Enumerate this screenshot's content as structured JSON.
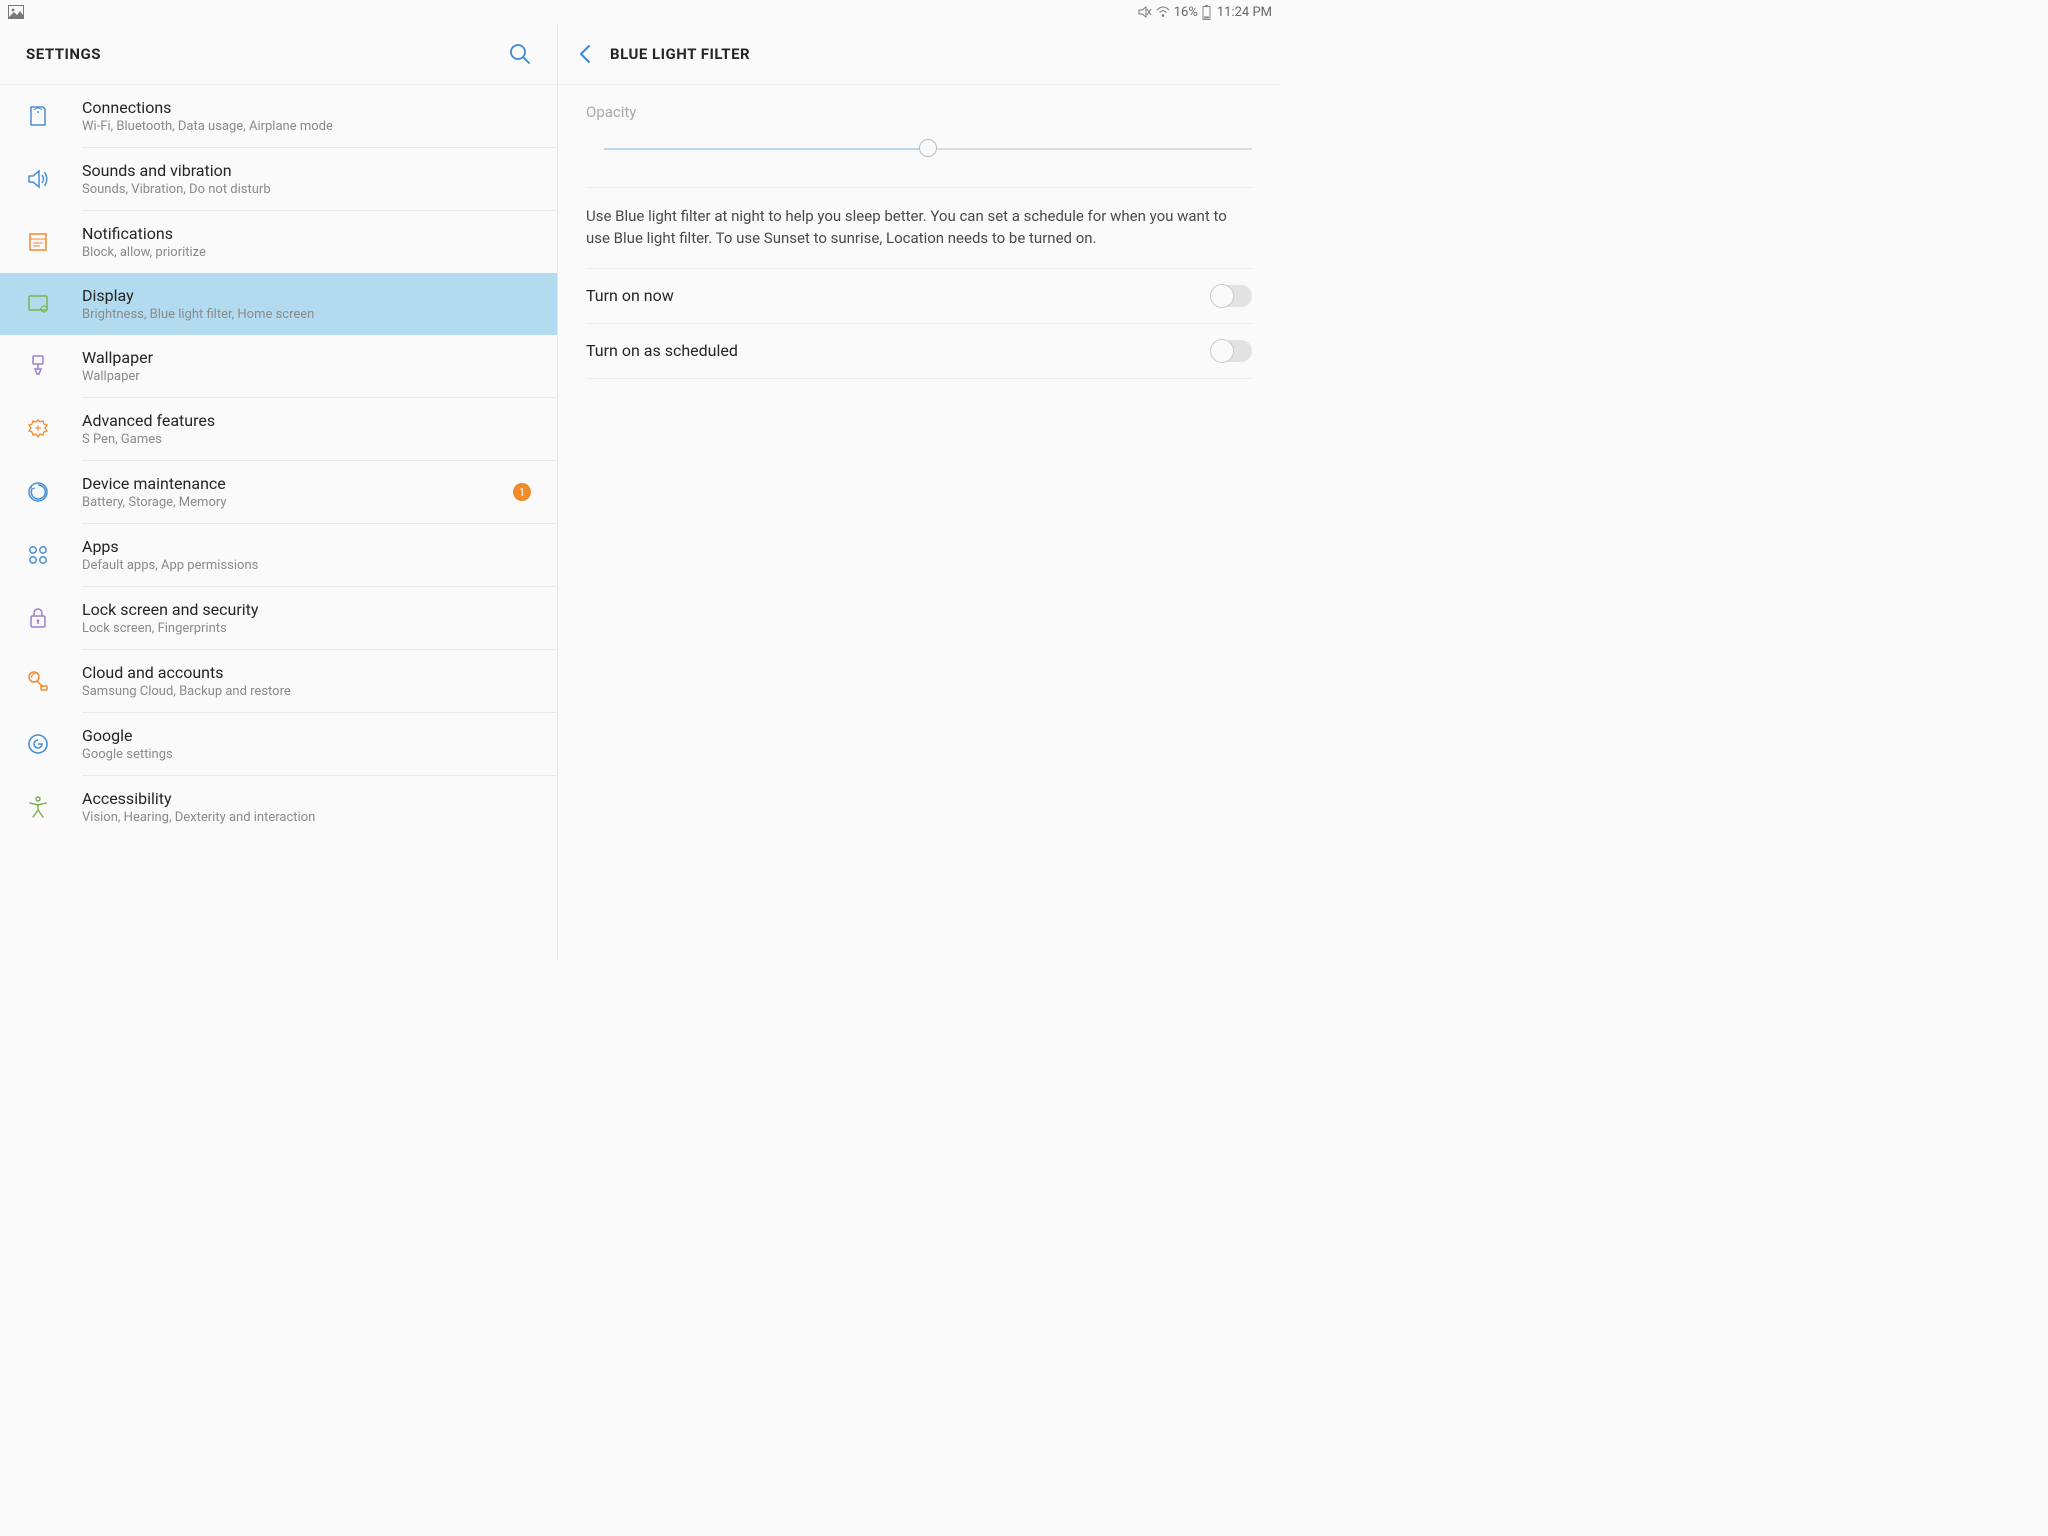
{
  "statusbar": {
    "battery_pct": "16%",
    "time": "11:24 PM"
  },
  "left": {
    "title": "SETTINGS",
    "categories": [
      {
        "title": "Connections",
        "subtitle": "Wi-Fi, Bluetooth, Data usage, Airplane mode",
        "color": "#4a8fd6",
        "selected": false,
        "badge": null
      },
      {
        "title": "Sounds and vibration",
        "subtitle": "Sounds, Vibration, Do not disturb",
        "color": "#4a8fd6",
        "selected": false,
        "badge": null
      },
      {
        "title": "Notifications",
        "subtitle": "Block, allow, prioritize",
        "color": "#ef8a33",
        "selected": false,
        "badge": null
      },
      {
        "title": "Display",
        "subtitle": "Brightness, Blue light filter, Home screen",
        "color": "#7fb152",
        "selected": true,
        "badge": null
      },
      {
        "title": "Wallpaper",
        "subtitle": "Wallpaper",
        "color": "#9b7fce",
        "selected": false,
        "badge": null
      },
      {
        "title": "Advanced features",
        "subtitle": "S Pen, Games",
        "color": "#ef8a33",
        "selected": false,
        "badge": null
      },
      {
        "title": "Device maintenance",
        "subtitle": "Battery, Storage, Memory",
        "color": "#4a8fd6",
        "selected": false,
        "badge": "1"
      },
      {
        "title": "Apps",
        "subtitle": "Default apps, App permissions",
        "color": "#4a8fd6",
        "selected": false,
        "badge": null
      },
      {
        "title": "Lock screen and security",
        "subtitle": "Lock screen, Fingerprints",
        "color": "#9b7fce",
        "selected": false,
        "badge": null
      },
      {
        "title": "Cloud and accounts",
        "subtitle": "Samsung Cloud, Backup and restore",
        "color": "#ef8a33",
        "selected": false,
        "badge": null
      },
      {
        "title": "Google",
        "subtitle": "Google settings",
        "color": "#4a8fd6",
        "selected": false,
        "badge": null
      },
      {
        "title": "Accessibility",
        "subtitle": "Vision, Hearing, Dexterity and interaction",
        "color": "#7fb152",
        "selected": false,
        "badge": null
      }
    ]
  },
  "right": {
    "title": "BLUE LIGHT FILTER",
    "opacity_label": "Opacity",
    "opacity_value": 50,
    "description": "Use Blue light filter at night to help you sleep better. You can set a schedule for when you want to use Blue light filter. To use Sunset to sunrise, Location needs to be turned on.",
    "toggles": [
      {
        "label": "Turn on now",
        "on": false
      },
      {
        "label": "Turn on as scheduled",
        "on": false
      }
    ]
  }
}
